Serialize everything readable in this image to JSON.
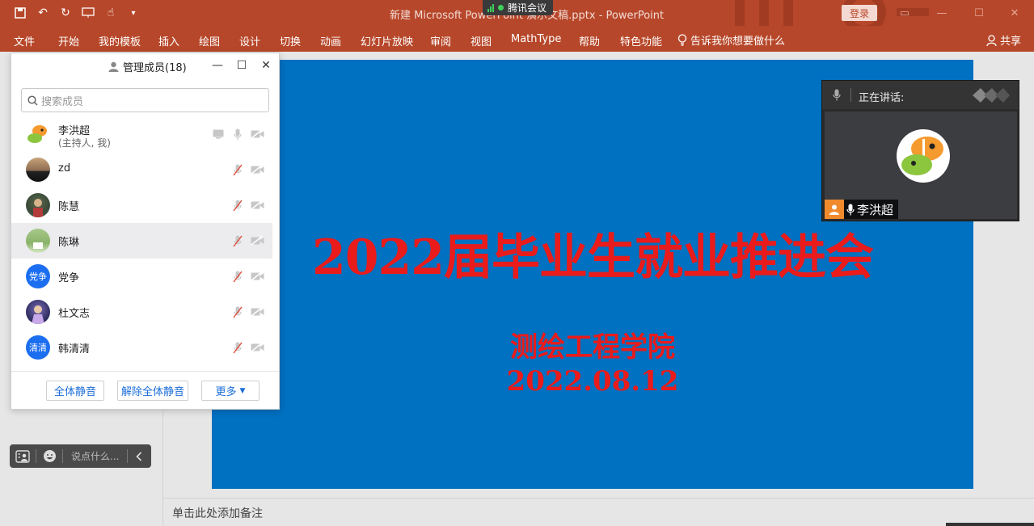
{
  "titlebar": {
    "doc_title": "新建 Microsoft PowerPoint 演示文稿.pptx  -  PowerPoint",
    "meeting_tag": "腾讯会议",
    "login_label": "登录",
    "accent": "#b7472a"
  },
  "ribbon": {
    "tabs": [
      "文件",
      "开始",
      "我的模板",
      "插入",
      "绘图",
      "设计",
      "切换",
      "动画",
      "幻灯片放映",
      "审阅",
      "视图",
      "MathType",
      "帮助",
      "特色功能"
    ],
    "tell_me": "告诉我你想要做什么",
    "share": "共享"
  },
  "slide": {
    "title": "2022届毕业生就业推进会",
    "subtitle": "测绘工程学院",
    "date": "2022.08.12",
    "background": "#0070c0",
    "text_color": "#ea1b1b"
  },
  "notes": {
    "placeholder": "单击此处添加备注"
  },
  "member_panel": {
    "title": "管理成员(18)",
    "search_placeholder": "搜索成员",
    "members": [
      {
        "name": "李洪超",
        "sub": "(主持人, 我)"
      },
      {
        "name": "zd"
      },
      {
        "name": "陈慧"
      },
      {
        "name": "陈琳"
      },
      {
        "name": "党争",
        "avatar_text": "党争"
      },
      {
        "name": "杜文志"
      },
      {
        "name": "韩清清",
        "avatar_text": "清清"
      }
    ],
    "footer": {
      "mute_all": "全体静音",
      "unmute_all": "解除全体静音",
      "more": "更多"
    }
  },
  "chatbar": {
    "placeholder": "说点什么..."
  },
  "speaking": {
    "label": "正在讲话:",
    "speaker_name": "李洪超"
  }
}
